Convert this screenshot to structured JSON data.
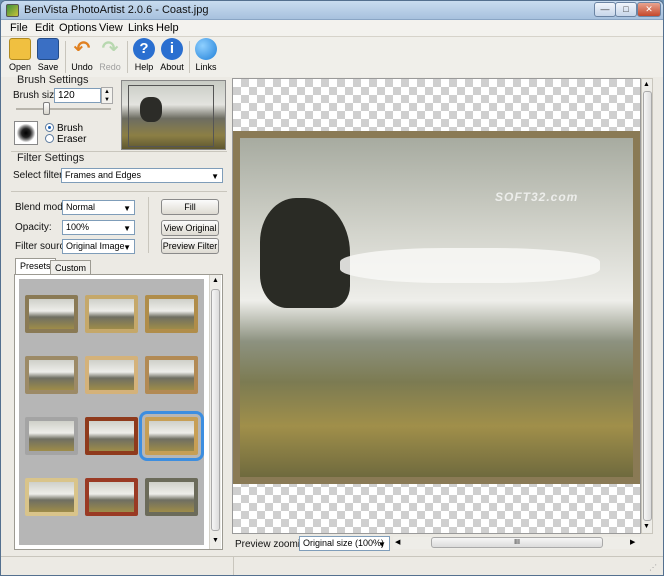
{
  "window": {
    "title": "BenVista PhotoArtist 2.0.6 - Coast.jpg",
    "min": "—",
    "max": "□",
    "close": "✕"
  },
  "menu": [
    "File",
    "Edit",
    "Options",
    "View",
    "Links",
    "Help"
  ],
  "toolbar": [
    {
      "label": "Open",
      "icon": "folder-open-icon",
      "color": "#f0c040"
    },
    {
      "label": "Save",
      "icon": "floppy-disk-icon",
      "color": "#3a6fc4"
    },
    {
      "label": "Undo",
      "icon": "undo-arrow-icon",
      "color": "#e08020"
    },
    {
      "label": "Redo",
      "icon": "redo-arrow-icon",
      "color": "#b8d8b0",
      "disabled": true
    },
    {
      "label": "Help",
      "icon": "help-question-icon",
      "color": "#2a6fd0"
    },
    {
      "label": "About",
      "icon": "info-icon",
      "color": "#2a6fd0"
    },
    {
      "label": "Links",
      "icon": "globe-icon",
      "color": "#1f7fd8"
    }
  ],
  "brush": {
    "group": "Brush Settings",
    "size_label": "Brush size:",
    "size_value": "120",
    "mode_brush": "Brush",
    "mode_eraser": "Eraser",
    "selected": "Brush"
  },
  "filter": {
    "group": "Filter Settings",
    "select_label": "Select filter:",
    "select_value": "Frames and Edges",
    "blend_label": "Blend mode:",
    "blend_value": "Normal",
    "opacity_label": "Opacity:",
    "opacity_value": "100%",
    "source_label": "Filter source:",
    "source_value": "Original Image",
    "fill": "Fill",
    "view_original": "View Original",
    "preview_filter": "Preview Filter"
  },
  "tabs": {
    "presets": "Presets",
    "custom": "Custom",
    "active": "Presets"
  },
  "presets": {
    "count": 12,
    "selected_index": 8
  },
  "preview": {
    "watermark": "SOFT32.com"
  },
  "bottom": {
    "zoom_label": "Preview zooming:",
    "zoom_value": "Original size (100%)",
    "scroll_grip": "III"
  },
  "colors": {
    "selection": "#3d8ee0",
    "frame": "#8a7a55"
  }
}
